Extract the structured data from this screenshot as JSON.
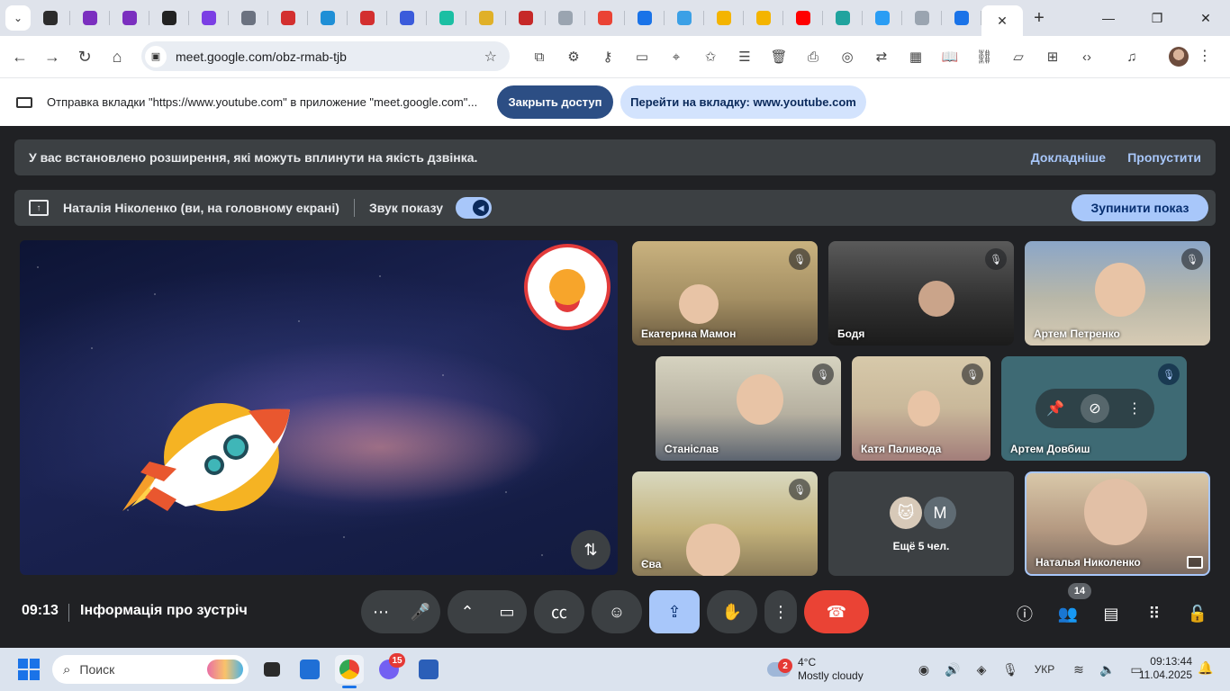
{
  "browser": {
    "tab_favicons": [
      {
        "name": "tab-favicon-1",
        "color": "#2c2c2c"
      },
      {
        "name": "tab-favicon-2",
        "color": "#7b2fbf"
      },
      {
        "name": "tab-favicon-3",
        "color": "#7b2fbf"
      },
      {
        "name": "tab-favicon-4",
        "color": "#222222"
      },
      {
        "name": "tab-favicon-5",
        "color": "#7b3fe4"
      },
      {
        "name": "tab-favicon-6",
        "color": "#6b7280"
      },
      {
        "name": "tab-favicon-7",
        "color": "#d32f2f"
      },
      {
        "name": "tab-favicon-8",
        "color": "#1f8fd6"
      },
      {
        "name": "tab-favicon-9",
        "color": "#d32f2f"
      },
      {
        "name": "tab-favicon-10",
        "color": "#3b5bdb"
      },
      {
        "name": "tab-favicon-11",
        "color": "#1bbfa3"
      },
      {
        "name": "tab-favicon-12",
        "color": "#e0b028"
      },
      {
        "name": "tab-favicon-13",
        "color": "#c62828"
      },
      {
        "name": "tab-favicon-14",
        "color": "#9aa4b0"
      },
      {
        "name": "tab-favicon-15",
        "color": "#ea4335"
      },
      {
        "name": "tab-favicon-16",
        "color": "#1a73e8"
      },
      {
        "name": "tab-favicon-17",
        "color": "#3ba0e6"
      },
      {
        "name": "tab-favicon-18",
        "color": "#f4b400"
      },
      {
        "name": "tab-favicon-19",
        "color": "#f4b400"
      },
      {
        "name": "tab-favicon-20",
        "color": "#ff0000"
      },
      {
        "name": "tab-favicon-21",
        "color": "#20a39e"
      },
      {
        "name": "tab-favicon-22",
        "color": "#2a9df4"
      },
      {
        "name": "tab-favicon-23",
        "color": "#9aa4b0"
      },
      {
        "name": "tab-favicon-24",
        "color": "#1a73e8"
      }
    ],
    "address": {
      "url": "meet.google.com/obz-rmab-tjb"
    }
  },
  "sharebar": {
    "message": "Отправка вкладки \"https://www.youtube.com\" в приложение \"meet.google.com\"...",
    "stop_label": "Закрыть доступ",
    "goto_label": "Перейти на вкладку: www.youtube.com"
  },
  "warning": {
    "text": "У вас встановлено розширення, які можуть вплинути на якість дзвінка.",
    "learn_more": "Докладніше",
    "skip": "Пропустити"
  },
  "presentation": {
    "presenter": "Наталія Ніколенко (ви, на головному екрані)",
    "sound_label": "Звук показу",
    "stop_label": "Зупинити показ"
  },
  "participants": [
    {
      "name": "Екатерина Мамон"
    },
    {
      "name": "Бодя"
    },
    {
      "name": "Артем Петренко"
    },
    {
      "name": "Станіслав"
    },
    {
      "name": "Катя Паливода"
    },
    {
      "name": "Артем Довбиш"
    },
    {
      "name": "Єва"
    },
    {
      "name": "Наталья Николенко"
    }
  ],
  "more_tile": {
    "avatar_letter": "M",
    "label": "Ещё 5 чел."
  },
  "controls": {
    "time": "09:13",
    "meeting_info": "Інформація про зустріч",
    "people_count": "14"
  },
  "taskbar": {
    "search_placeholder": "Поиск",
    "viber_badge": "15",
    "weather_badge": "2",
    "temperature": "4°C",
    "weather": "Mostly cloudy",
    "language": "УКР",
    "clock_time": "09:13:44",
    "clock_date": "11.04.2025"
  }
}
